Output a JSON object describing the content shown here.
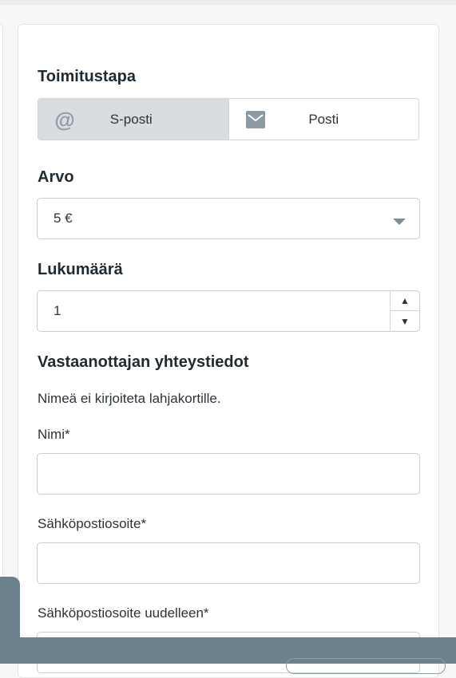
{
  "delivery": {
    "title": "Toimitustapa",
    "options": [
      {
        "label": "S-posti",
        "icon": "at-icon",
        "selected": true
      },
      {
        "label": "Posti",
        "icon": "envelope-icon",
        "selected": false
      }
    ]
  },
  "value": {
    "title": "Arvo",
    "selected": "5 €",
    "icon": "chevron-down-icon"
  },
  "quantity": {
    "title": "Lukumäärä",
    "value": "1",
    "up_symbol": "▲",
    "down_symbol": "▼"
  },
  "recipient": {
    "title": "Vastaanottajan yhteystiedot",
    "note": "Nimeä ei kirjoiteta lahjakortille.",
    "name_label": "Nimi*",
    "email_label": "Sähköpostiosoite*",
    "email_repeat_label": "Sähköpostiosoite uudelleen*"
  },
  "colors": {
    "selected_segment": "#d7dde1",
    "footer": "#6b828d",
    "icon_grey": "#8c9aa3"
  }
}
